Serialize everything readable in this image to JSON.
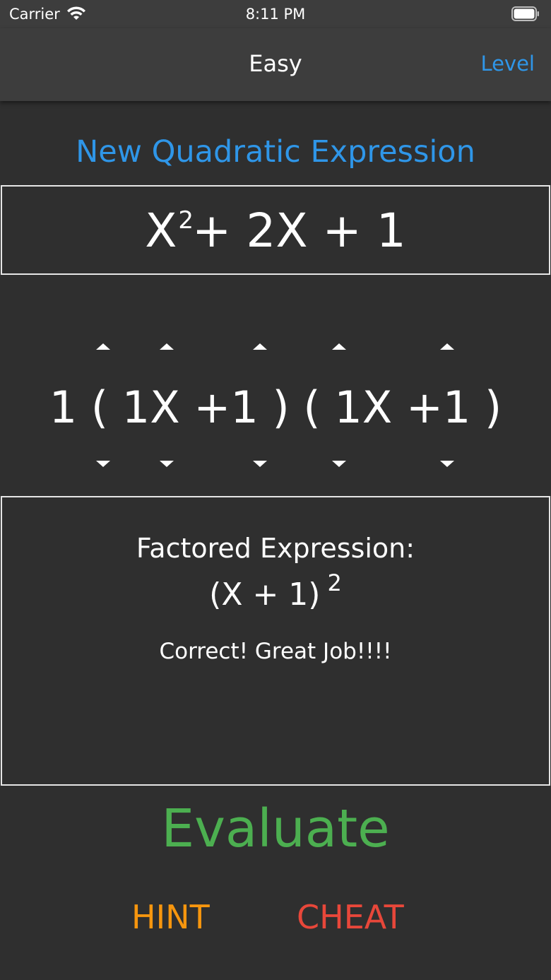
{
  "status_bar": {
    "carrier": "Carrier",
    "time": "8:11 PM"
  },
  "nav": {
    "title": "Easy",
    "level_label": "Level"
  },
  "new_expression_label": "New Quadratic Expression",
  "expression": {
    "base": "X",
    "exponent": "2",
    "rest": "+ 2X + 1"
  },
  "factor_picker": {
    "text": "1 ( 1X +1 ) ( 1X +1 )",
    "up_arrow_count": 5,
    "down_arrow_count": 5
  },
  "result": {
    "label": "Factored Expression:",
    "value": "(X  + 1)",
    "value_exponent": "2",
    "message": "Correct!  Great Job!!!!"
  },
  "actions": {
    "evaluate": "Evaluate",
    "hint": "HINT",
    "cheat": "CHEAT"
  },
  "colors": {
    "background": "#2f2f2f",
    "bar": "#3d3d3d",
    "accent_blue": "#2f96e8",
    "evaluate_green": "#4caf50",
    "hint_orange": "#f7960e",
    "cheat_red": "#e8473a"
  },
  "icons": {
    "wifi": "wifi-icon",
    "battery": "battery-icon",
    "increment": "chevron-up-icon",
    "decrement": "chevron-down-icon"
  }
}
